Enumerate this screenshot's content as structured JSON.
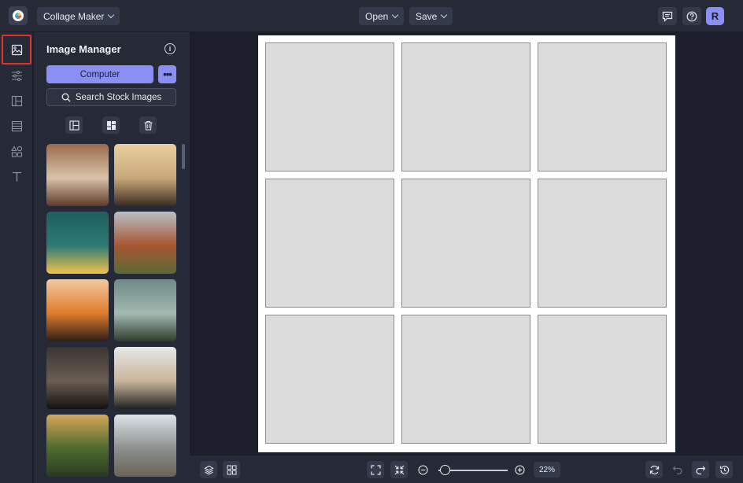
{
  "topbar": {
    "app_menu_label": "Collage Maker",
    "open_label": "Open",
    "save_label": "Save",
    "avatar_initial": "R"
  },
  "sidebar_rail": {
    "items": [
      "image-manager-icon",
      "adjustments-icon",
      "layouts-icon",
      "backgrounds-icon",
      "graphics-icon",
      "text-icon"
    ],
    "active": "image-manager-icon"
  },
  "panel": {
    "title": "Image Manager",
    "info_glyph": "i",
    "computer_label": "Computer",
    "more_glyph": "•••",
    "stock_label": "Search Stock Images",
    "thumbnails": [
      {
        "subject": "canyon",
        "colors": [
          "#9b6b4d",
          "#d9c2a8",
          "#5e3a2a"
        ]
      },
      {
        "subject": "desert butte",
        "colors": [
          "#e9cf9f",
          "#c9a878",
          "#3b2b22"
        ]
      },
      {
        "subject": "hotel monte vista sign",
        "colors": [
          "#1f5e5d",
          "#2d7a74",
          "#f2c24e"
        ]
      },
      {
        "subject": "red rock mountain",
        "colors": [
          "#b7bfc7",
          "#a7562f",
          "#5a6a3a"
        ]
      },
      {
        "subject": "sunset road",
        "colors": [
          "#f2c9a0",
          "#e07b2b",
          "#2d1e18"
        ]
      },
      {
        "subject": "green hill",
        "colors": [
          "#6d8a86",
          "#a3b9b2",
          "#2e3d2c"
        ]
      },
      {
        "subject": "foggy figures",
        "colors": [
          "#3a3634",
          "#6a5d52",
          "#141210"
        ]
      },
      {
        "subject": "motorcycle rider",
        "colors": [
          "#e6e8ea",
          "#c9b59a",
          "#222"
        ]
      },
      {
        "subject": "forest road",
        "colors": [
          "#d3a85a",
          "#4d6a2e",
          "#2a3a22"
        ]
      },
      {
        "subject": "snowy mountains",
        "colors": [
          "#dfe3e6",
          "#8a8f8d",
          "#6b6256"
        ]
      }
    ]
  },
  "bottombar": {
    "zoom_value": "22%",
    "zoom_fraction": 0.22
  },
  "collage": {
    "rows": 3,
    "cols": 3
  }
}
